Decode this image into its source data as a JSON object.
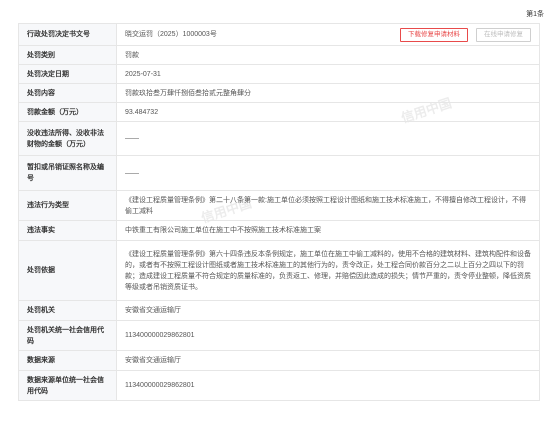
{
  "page_counter": "第1条",
  "actions": {
    "download_label": "下载修复申请材料",
    "online_label": "在线申请修复"
  },
  "rows": [
    {
      "label": "行政处罚决定书文号",
      "value": "晓交运罚（2025）1000003号"
    },
    {
      "label": "处罚类别",
      "value": "罚款"
    },
    {
      "label": "处罚决定日期",
      "value": "2025-07-31"
    },
    {
      "label": "处罚内容",
      "value": "罚款玖拾叁万肆仟捌佰叁拾贰元整角肆分"
    },
    {
      "label": "罚款金额（万元）",
      "value": "93.484732"
    },
    {
      "label": "没收违法所得、没收非法财物的金额（万元）",
      "value": "——"
    },
    {
      "label": "暂扣或吊销证照名称及编号",
      "value": "——"
    },
    {
      "label": "违法行为类型",
      "value": "《建设工程质量管理条例》第二十八条第一款:施工单位必须按照工程设计图纸和施工技术标准施工，不得擅自修改工程设计，不得偷工减料"
    },
    {
      "label": "违法事实",
      "value": "中铁重工有限公司施工单位在施工中不按照施工技术标准施工案"
    },
    {
      "label": "处罚依据",
      "value": "《建设工程质量管理条例》第六十四条违反本条例规定，施工单位在施工中偷工减料的，使用不合格的建筑材料、建筑构配件和设备的，或者有不按照工程设计图纸或者施工技术标准施工的其他行为的，责令改正，处工程合同价款百分之二以上百分之四以下的罚款；造成建设工程质量不符合规定的质量标准的，负责返工、修理，并赔偿因此造成的损失；情节严重的，责令停业整顿，降低资质等级或者吊销资质证书。"
    },
    {
      "label": "处罚机关",
      "value": "安徽省交通运输厅"
    },
    {
      "label": "处罚机关统一社会信用代码",
      "value": "113400000029862801"
    },
    {
      "label": "数据来源",
      "value": "安徽省交通运输厅"
    },
    {
      "label": "数据来源单位统一社会信用代码",
      "value": "113400000029862801"
    }
  ]
}
